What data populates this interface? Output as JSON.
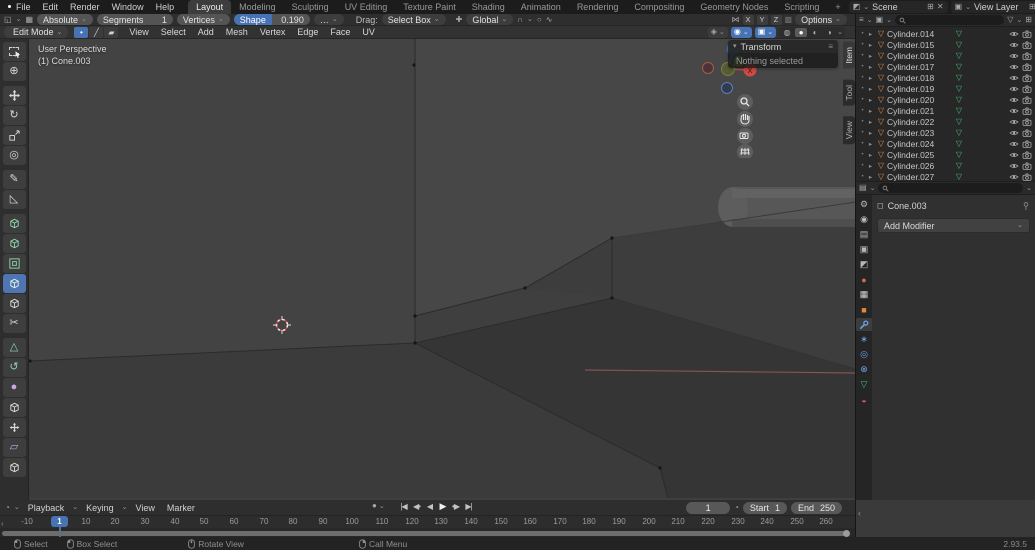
{
  "colors": {
    "accent_blue": "#4772b3",
    "active_tool_blue": "#4f76b3",
    "object_orange": "#e08a3c",
    "mesh_data_green": "#3fbf76",
    "world_red": "#c96a5a",
    "modifier_blue": "#6aa5e8",
    "axis_x_red": "#cf4a43",
    "axis_y_green": "#6fae3a",
    "axis_z_blue": "#3b6cbf",
    "viewport_gray": "#3f3f3f"
  },
  "glyphs": {
    "dropdown": "⌄",
    "dot": "•",
    "arrow_right": "▸",
    "tri": "▽",
    "menu_lines": "≡",
    "grid": "▤",
    "box": "▦",
    "plus": "⊞",
    "close": "✕",
    "funnel": "▽",
    "clock": "◔",
    "chevron_left": "‹",
    "overlays": "◉",
    "xray": "▣",
    "wireframe": "◍",
    "solid": "●",
    "material_preview": "◐",
    "rendered": "◑",
    "gizmo_toggle": "◈",
    "magnet": "∩",
    "prop_edit": "○",
    "prop_falloff": "∿",
    "butterfly": "⋈",
    "orientation": "✚",
    "editor_icon": "◱",
    "scene_icon": "◩",
    "layer_icon": "▣",
    "record": "●",
    "ellipsis": "…",
    "vertex_mode": "•",
    "edge_mode": "╱",
    "face_mode": "▰",
    "object_frame": "◻",
    "dim_box": "▩"
  },
  "topbar": {
    "menus": [
      "File",
      "Edit",
      "Render",
      "Window",
      "Help"
    ],
    "tabs": [
      "Layout",
      "Modeling",
      "Sculpting",
      "UV Editing",
      "Texture Paint",
      "Shading",
      "Animation",
      "Rendering",
      "Compositing",
      "Geometry Nodes",
      "Scripting"
    ],
    "add_tab": "+",
    "scene_name": "Scene",
    "view_layer_name": "View Layer"
  },
  "tool_settings": {
    "snap_mode": "Absolute",
    "segments_label": "Segments",
    "segments_value": "1",
    "mode": "Vertices",
    "shape_label": "Shape",
    "shape_value": "0.190",
    "drag_label": "Drag:",
    "drag_tool": "Select Box",
    "orientation": "Global",
    "axis_x": "X",
    "axis_y": "Y",
    "axis_z": "Z",
    "options_label": "Options"
  },
  "viewport": {
    "mode": "Edit Mode",
    "menus": [
      "View",
      "Select",
      "Add",
      "Mesh",
      "Vertex",
      "Edge",
      "Face",
      "UV"
    ],
    "overlay_line1": "User Perspective",
    "overlay_line2": "(1) Cone.003",
    "transform_panel": {
      "title": "Transform",
      "message": "Nothing selected"
    },
    "side_tabs": [
      "Item",
      "Tool",
      "View"
    ],
    "gizmo": {
      "x": "X",
      "y": "Y",
      "z": "Z"
    }
  },
  "toolbar": {
    "tools": [
      {
        "name": "select-box",
        "glyph": ""
      },
      {
        "name": "cursor",
        "glyph": "⊕"
      },
      {
        "name": "move",
        "glyph": ""
      },
      {
        "name": "rotate",
        "glyph": "↻"
      },
      {
        "name": "scale",
        "glyph": ""
      },
      {
        "name": "transform",
        "glyph": "◎"
      },
      {
        "name": "annotate",
        "glyph": "✎"
      },
      {
        "name": "measure",
        "glyph": "◺"
      },
      {
        "name": "add-cube",
        "glyph": ""
      },
      {
        "name": "extrude-region",
        "glyph": ""
      },
      {
        "name": "inset-faces",
        "glyph": ""
      },
      {
        "name": "bevel",
        "glyph": ""
      },
      {
        "name": "loop-cut",
        "glyph": ""
      },
      {
        "name": "knife",
        "glyph": "✂"
      },
      {
        "name": "poly-build",
        "glyph": "△"
      },
      {
        "name": "spin",
        "glyph": "↺"
      },
      {
        "name": "smooth",
        "glyph": "●"
      },
      {
        "name": "edge-slide",
        "glyph": ""
      },
      {
        "name": "shrink-fatten",
        "glyph": ""
      },
      {
        "name": "shear",
        "glyph": "▱"
      },
      {
        "name": "rip-region",
        "glyph": ""
      }
    ]
  },
  "outliner": {
    "rows": [
      {
        "name": "Cylinder.014"
      },
      {
        "name": "Cylinder.015"
      },
      {
        "name": "Cylinder.016"
      },
      {
        "name": "Cylinder.017"
      },
      {
        "name": "Cylinder.018"
      },
      {
        "name": "Cylinder.019"
      },
      {
        "name": "Cylinder.020"
      },
      {
        "name": "Cylinder.021"
      },
      {
        "name": "Cylinder.022"
      },
      {
        "name": "Cylinder.023"
      },
      {
        "name": "Cylinder.024"
      },
      {
        "name": "Cylinder.025"
      },
      {
        "name": "Cylinder.026"
      },
      {
        "name": "Cylinder.027"
      }
    ]
  },
  "properties": {
    "tabs": [
      {
        "name": "tool",
        "glyph": "⚙"
      },
      {
        "name": "render",
        "glyph": "◉"
      },
      {
        "name": "output",
        "glyph": "▤"
      },
      {
        "name": "view-layer",
        "glyph": "▣"
      },
      {
        "name": "scene",
        "glyph": "◩"
      },
      {
        "name": "world",
        "glyph": "●"
      },
      {
        "name": "collection",
        "glyph": "▦"
      },
      {
        "name": "object",
        "glyph": "■"
      },
      {
        "name": "modifiers",
        "glyph": ""
      },
      {
        "name": "particles",
        "glyph": "∗"
      },
      {
        "name": "physics",
        "glyph": "◎"
      },
      {
        "name": "constraints",
        "glyph": "⊗"
      },
      {
        "name": "data",
        "glyph": "▽"
      },
      {
        "name": "material",
        "glyph": "◒"
      }
    ],
    "active_tab": "modifiers",
    "breadcrumb": "Cone.003",
    "add_modifier_label": "Add Modifier"
  },
  "timeline": {
    "menus": [
      "Playback",
      "Keying",
      "View",
      "Marker"
    ],
    "transport": [
      "|◀",
      "◀•",
      "◀",
      "▶",
      "•▶",
      "▶|"
    ],
    "current_frame": "1",
    "start_label": "Start",
    "start_value": "1",
    "end_label": "End",
    "end_value": "250",
    "ticks": [
      "-10",
      "1",
      "10",
      "20",
      "30",
      "40",
      "50",
      "60",
      "70",
      "80",
      "90",
      "100",
      "110",
      "120",
      "130",
      "140",
      "150",
      "160",
      "170",
      "180",
      "190",
      "200",
      "210",
      "220",
      "230",
      "240",
      "250",
      "260"
    ]
  },
  "statusbar": {
    "hints": [
      {
        "label": "Select"
      },
      {
        "label": "Box Select"
      },
      {
        "label": "Rotate View"
      },
      {
        "label": "Call Menu"
      }
    ],
    "version": "2.93.5"
  }
}
